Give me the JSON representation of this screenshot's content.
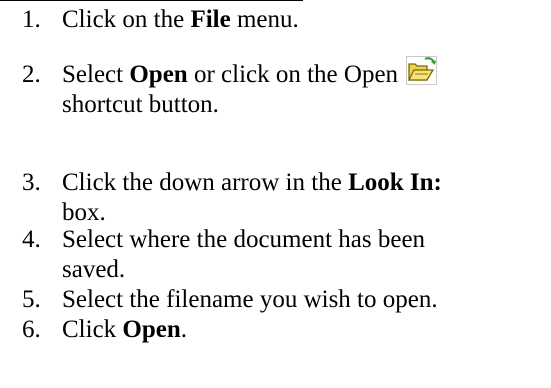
{
  "steps": [
    {
      "number": "1.",
      "prefix": "Click on the ",
      "bold": "File",
      "suffix": " menu."
    },
    {
      "number": "2.",
      "prefix": "Select ",
      "bold": "Open",
      "suffix": " or click on the Open",
      "icon": "open-folder-icon",
      "line2": "shortcut button."
    },
    {
      "number": "3.",
      "prefix": "Click the down arrow in the ",
      "bold": "Look In:",
      "line2": "box."
    },
    {
      "number": "4.",
      "text": "Select where the document has been",
      "line2": "saved."
    },
    {
      "number": "5.",
      "text": "Select the filename you wish to open."
    },
    {
      "number": "6.",
      "prefix": "Click ",
      "bold": "Open",
      "suffix": "."
    }
  ],
  "colors": {
    "text": "#000000",
    "background": "#ffffff",
    "folder_yellow": "#f2d24a",
    "folder_outline": "#7a6a00",
    "arrow_green": "#2f9e3a"
  }
}
